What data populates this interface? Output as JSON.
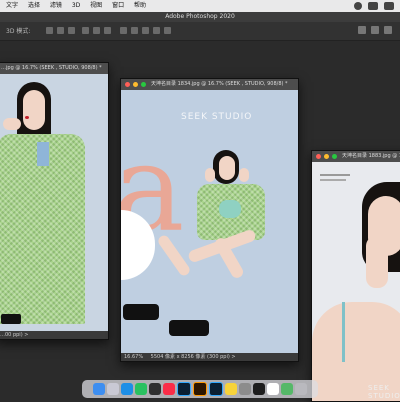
{
  "menubar": {
    "items": [
      "文字",
      "选择",
      "滤镜",
      "3D",
      "视图",
      "窗口",
      "帮助"
    ],
    "apple_menu_icon": "apple-icon"
  },
  "app": {
    "title": "Adobe Photoshop 2020"
  },
  "options_bar": {
    "label": "3D 模式:"
  },
  "windows": [
    {
      "title": "…jpg @ 16.7% (SEEK , STUDIO, 908/8) *",
      "status": "…00 ppi) >"
    },
    {
      "title": "天坤名目录 1834.jpg @ 16.7% (SEEK , STUDIO, 908/8) *",
      "canvas_text": "SEEK STUDIO",
      "big_letter": "a",
      "zoom": "16.67%",
      "status": "5504 像素 x 8256 像素 (300 ppi) >"
    },
    {
      "title": "天坤名目录 1883.jpg @ 16.7%",
      "watermark": "SEEK STUDIO"
    }
  ],
  "dock": {
    "apps": [
      {
        "name": "finder",
        "color": "#3d8ef0"
      },
      {
        "name": "launchpad",
        "color": "#c9c9d4"
      },
      {
        "name": "safari",
        "color": "#1e8fe6"
      },
      {
        "name": "wechat",
        "color": "#2ac160"
      },
      {
        "name": "qq",
        "color": "#2f2f2f"
      },
      {
        "name": "music",
        "color": "#fa2d48"
      },
      {
        "name": "photoshop",
        "color": "#0a1f33"
      },
      {
        "name": "illustrator",
        "color": "#2b1600"
      },
      {
        "name": "lightroom",
        "color": "#0b2033"
      },
      {
        "name": "notes",
        "color": "#f7d33a"
      },
      {
        "name": "system-preferences",
        "color": "#8c8c8c"
      },
      {
        "name": "terminal",
        "color": "#1e1e1e"
      },
      {
        "name": "calendar",
        "color": "#ffffff"
      },
      {
        "name": "maps",
        "color": "#55b868"
      },
      {
        "name": "trash",
        "color": "#b9b9be"
      }
    ]
  }
}
